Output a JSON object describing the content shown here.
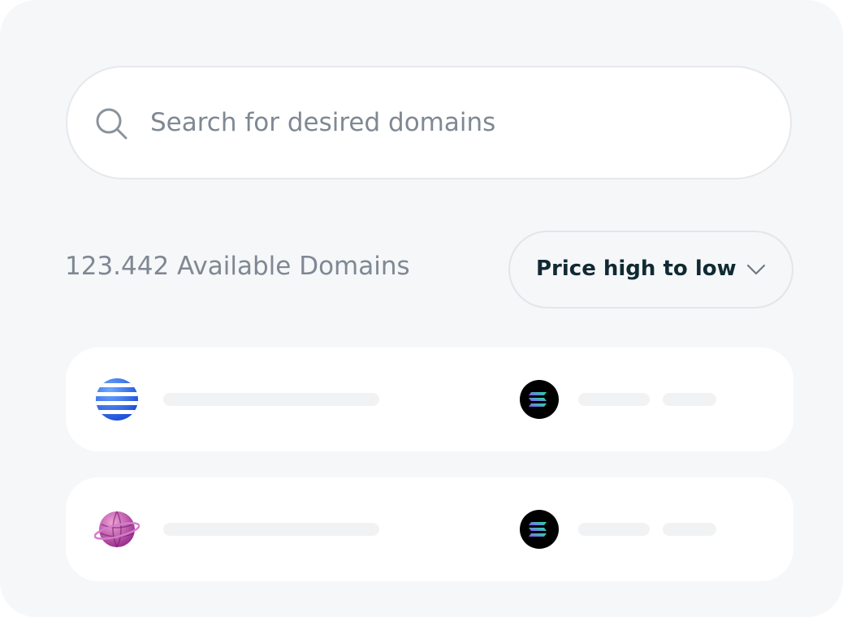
{
  "search": {
    "placeholder": "Search for desired domains",
    "icon": "search-icon"
  },
  "results": {
    "count_label": "123.442 Available Domains"
  },
  "sort": {
    "label": "Price high to low",
    "icon": "chevron-down-icon"
  },
  "domain_rows": [
    {
      "avatar_icon": "blue-striped-sphere-icon",
      "currency_icon": "solana-icon",
      "loading": true
    },
    {
      "avatar_icon": "pink-planet-icon",
      "currency_icon": "solana-icon",
      "loading": true
    }
  ],
  "colors": {
    "background": "#f6f7f9",
    "card": "#ffffff",
    "muted_text": "#7f8893",
    "dark_text": "#102a33",
    "skeleton": "#f1f2f4"
  }
}
